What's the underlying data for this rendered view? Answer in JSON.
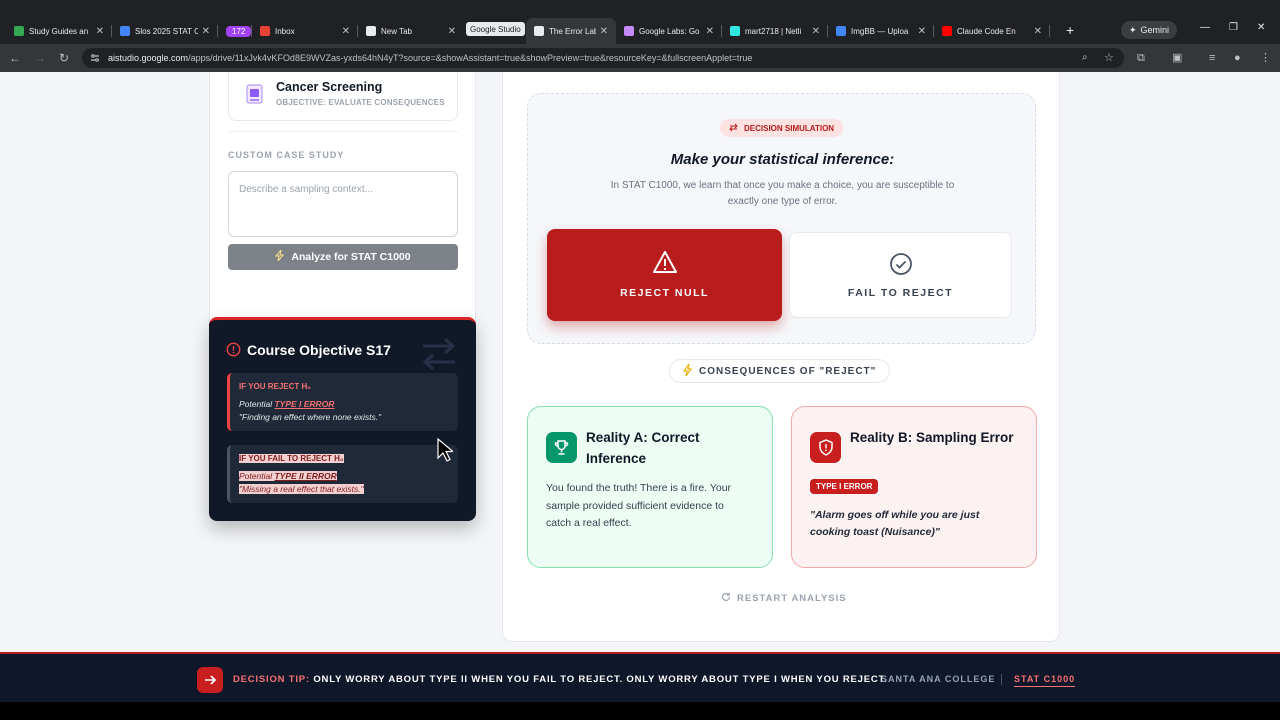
{
  "browser": {
    "tabs": [
      {
        "title": "Study Guides an",
        "icon": "google-drive-icon",
        "color": "#34a853"
      },
      {
        "title": "Slos 2025 STAT C",
        "icon": "google-docs-icon",
        "color": "#4285f4"
      },
      {
        "title": "172",
        "icon": "tab-count-badge",
        "color": "#a142f4"
      },
      {
        "title": "Inbox",
        "icon": "mail-icon",
        "color": "#ea4335"
      },
      {
        "title": "New Tab",
        "icon": "chrome-icon",
        "color": "#e8eaed"
      },
      {
        "title": "The Error Lab: Ty",
        "icon": "ai-studio-icon",
        "color": "#e8eaed"
      },
      {
        "title": "Google Labs: Go",
        "icon": "google-labs-icon",
        "color": "#c58af9"
      },
      {
        "title": "mart2718 | Netli",
        "icon": "netlify-icon",
        "color": "#32e6e2"
      },
      {
        "title": "ImgBB — Uploa",
        "icon": "imgbb-icon",
        "color": "#4285f4"
      },
      {
        "title": "Claude Code En",
        "icon": "youtube-icon",
        "color": "#ff0000"
      }
    ],
    "tab_group_label": "Google Studio",
    "gemini_label": "Gemini",
    "url_host": "aistudio.google.com",
    "url_path": "/apps/drive/11xJvk4vKFOd8E9WVZas-yxds64hN4yT?source=&showAssistant=true&showPreview=true&resourceKey=&fullscreenApplet=true"
  },
  "sidebar": {
    "case_title": "Cancer Screening",
    "case_subtitle": "OBJECTIVE: EVALUATE CONSEQUENCES",
    "custom_label": "CUSTOM CASE STUDY",
    "custom_placeholder": "Describe a sampling context...",
    "analyze_label": "Analyze for STAT C1000"
  },
  "objective": {
    "title": "Course Objective S17",
    "reject": {
      "heading": "IF YOU REJECT H₀",
      "potential": "Potential",
      "error": "TYPE I ERROR",
      "quote": "\"Finding an effect where none exists.\""
    },
    "fail": {
      "heading": "IF YOU FAIL TO REJECT H₀",
      "potential": "Potential",
      "error": "TYPE II ERROR",
      "quote": "\"Missing a real effect that exists.\""
    }
  },
  "simulation": {
    "pill": "DECISION SIMULATION",
    "title": "Make your statistical inference:",
    "description": "In STAT C1000, we learn that once you make a choice, you are susceptible to exactly one type of error.",
    "reject_label": "REJECT NULL",
    "fail_label": "FAIL TO REJECT"
  },
  "consequences": {
    "label": "CONSEQUENCES OF \"REJECT\"",
    "reality_a": {
      "title": "Reality A: Correct Inference",
      "body": "You found the truth! There is a fire. Your sample provided sufficient evidence to catch a real effect."
    },
    "reality_b": {
      "title": "Reality B: Sampling Error",
      "badge": "TYPE I ERROR",
      "quote": "\"Alarm goes off while you are just cooking toast (Nuisance)\""
    },
    "restart_label": "RESTART ANALYSIS"
  },
  "footer": {
    "tip_label": "DECISION TIP:",
    "tip_text": "ONLY WORRY ABOUT TYPE II WHEN YOU FAIL TO REJECT. ONLY WORRY ABOUT TYPE I WHEN YOU REJECT.",
    "college": "SANTA ANA COLLEGE",
    "course": "STAT C1000"
  },
  "colors": {
    "accent_red": "#b91c1c",
    "success_green": "#059669",
    "dark_panel": "#111827"
  }
}
